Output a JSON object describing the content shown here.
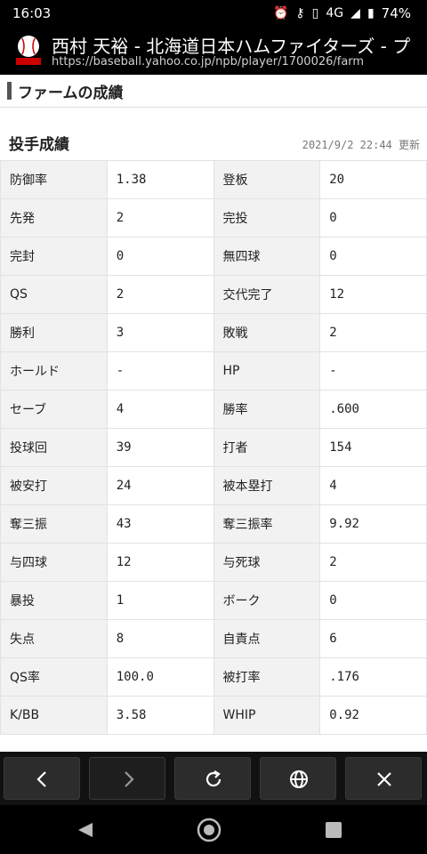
{
  "status": {
    "time": "16:03",
    "network": "4G",
    "battery": "74%"
  },
  "browser": {
    "title": "西村 天裕 - 北海道日本ハムファイターズ - プ",
    "url": "https://baseball.yahoo.co.jp/npb/player/1700026/farm"
  },
  "section_title": "ファームの成績",
  "pitching": {
    "title": "投手成績",
    "updated": "2021/9/2 22:44 更新",
    "rows": [
      [
        "防御率",
        "1.38",
        "登板",
        "20"
      ],
      [
        "先発",
        "2",
        "完投",
        "0"
      ],
      [
        "完封",
        "0",
        "無四球",
        "0"
      ],
      [
        "QS",
        "2",
        "交代完了",
        "12"
      ],
      [
        "勝利",
        "3",
        "敗戦",
        "2"
      ],
      [
        "ホールド",
        "-",
        "HP",
        "-"
      ],
      [
        "セーブ",
        "4",
        "勝率",
        ".600"
      ],
      [
        "投球回",
        "39",
        "打者",
        "154"
      ],
      [
        "被安打",
        "24",
        "被本塁打",
        "4"
      ],
      [
        "奪三振",
        "43",
        "奪三振率",
        "9.92"
      ],
      [
        "与四球",
        "12",
        "与死球",
        "2"
      ],
      [
        "暴投",
        "1",
        "ボーク",
        "0"
      ],
      [
        "失点",
        "8",
        "自責点",
        "6"
      ],
      [
        "QS率",
        "100.0",
        "被打率",
        ".176"
      ],
      [
        "K/BB",
        "3.58",
        "WHIP",
        "0.92"
      ]
    ]
  },
  "icons": {
    "logo": "sportsnavi-logo",
    "toolbar": [
      "back-icon",
      "forward-icon",
      "reload-icon",
      "globe-icon",
      "close-icon"
    ],
    "nav": [
      "nav-back-icon",
      "nav-home-icon",
      "nav-recents-icon"
    ]
  }
}
